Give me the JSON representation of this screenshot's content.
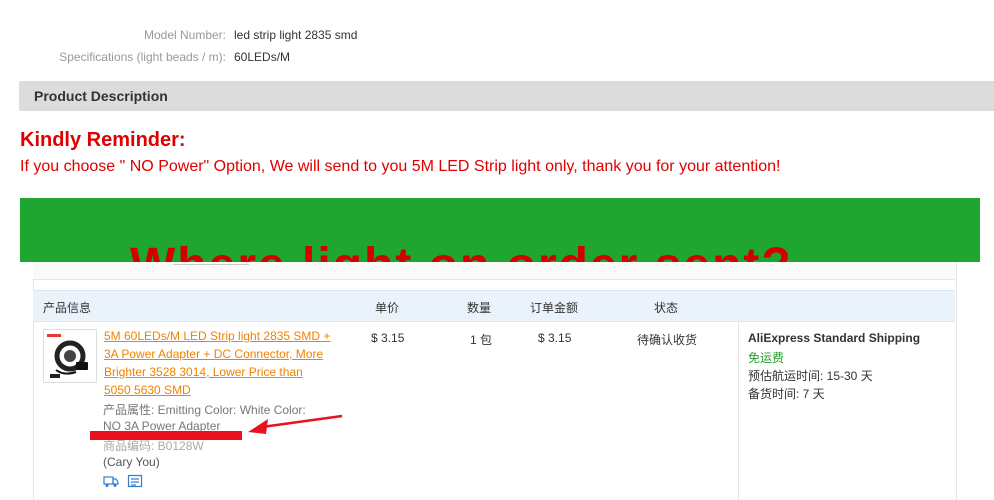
{
  "specs": [
    {
      "label": "Model Number:",
      "value": "led strip light 2835 smd"
    },
    {
      "label": "Specifications (light beads / m):",
      "value": "60LEDs/M"
    }
  ],
  "product_description_title": "Product Description",
  "reminder": {
    "title": "Kindly Reminder:",
    "text": "If you choose \" NO Power\" Option, We will send to you 5M LED Strip light only, thank you for your attention!"
  },
  "banner": {
    "text": "Where  light  on  order  sent?",
    "background": "#1fa630",
    "text_color": "#d40000"
  },
  "order_table": {
    "headers": [
      "产品信息",
      "单价",
      "数量",
      "订单金额",
      "状态"
    ],
    "product_title": "5M 60LEDs/M LED Strip light 2835 SMD + 3A Power Adapter + DC Connector, More Brighter 3528 3014, Lower Price than 5050 5630 SMD",
    "attributes_line1": "产品属性: Emitting Color: White     Color:",
    "attributes_line2": "NO 3A Power Adapter",
    "product_code": "商品编码: B0128W",
    "buyer": "(Cary You)",
    "price": "$ 3.15",
    "quantity": "1 包",
    "amount": "$ 3.15",
    "status": "待确认收货",
    "shipping": {
      "method": "AliExpress Standard Shipping",
      "free": "免运费",
      "estimated": "预估航运时间: 15-30 天",
      "handling": "备货时间: 7 天"
    },
    "icons": [
      "truck-icon",
      "list-icon"
    ]
  },
  "colors": {
    "reminder_red": "#e00000",
    "link_orange": "#f08200",
    "header_blue": "#eaf3fb",
    "annotation_red": "#e8121e",
    "free_green": "#2a9d2a"
  }
}
